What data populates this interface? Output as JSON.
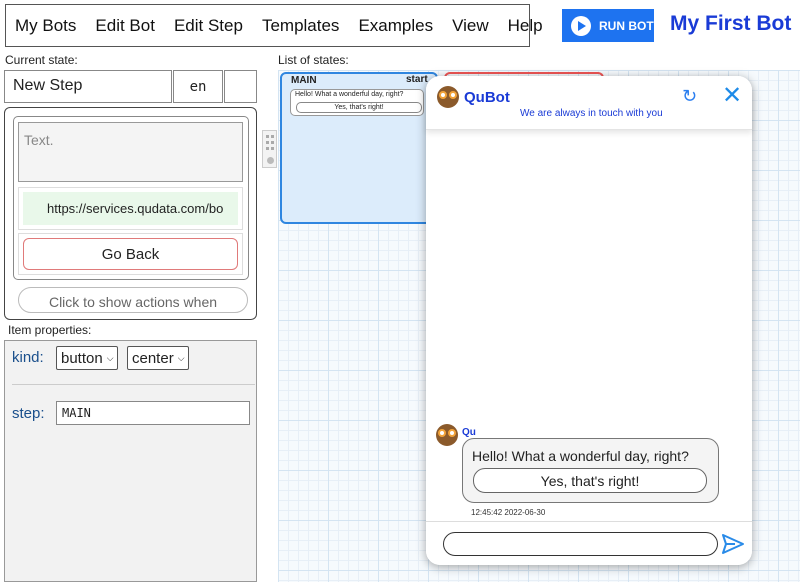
{
  "menu": {
    "items": [
      "My Bots",
      "Edit Bot",
      "Edit Step",
      "Templates",
      "Examples",
      "View",
      "Help"
    ]
  },
  "header": {
    "run_button": "RUN BOT",
    "bot_name": "My First Bot"
  },
  "left_panel": {
    "current_state_label": "Current state:",
    "state_name": "New Step",
    "language": "en",
    "text_placeholder": "Text.",
    "url_value": "https://services.qudata.com/bo",
    "go_back_label": "Go Back",
    "actions_hint": "Click to show actions when"
  },
  "properties": {
    "label": "Item properties:",
    "kind_label": "kind:",
    "kind_value": "button",
    "align_value": "center",
    "step_label": "step:",
    "step_value": "MAIN"
  },
  "states_list": {
    "label": "List of states:",
    "card": {
      "title": "MAIN",
      "badge": "start",
      "message": "Hello! What a wonderful day, right?",
      "button": "Yes, that's right!"
    }
  },
  "chat": {
    "title": "QuBot",
    "subtitle": "We are always in touch with you",
    "sender": "Qu",
    "message": "Hello! What a wonderful day, right?",
    "reply_button": "Yes, that's right!",
    "timestamp": "12:45:42 2022-06-30",
    "accent_color": "#1a3bd6"
  },
  "icons": {
    "run": "play-icon",
    "refresh": "refresh-icon",
    "close": "close-icon",
    "send": "send-icon",
    "avatar": "owl-avatar-icon"
  }
}
